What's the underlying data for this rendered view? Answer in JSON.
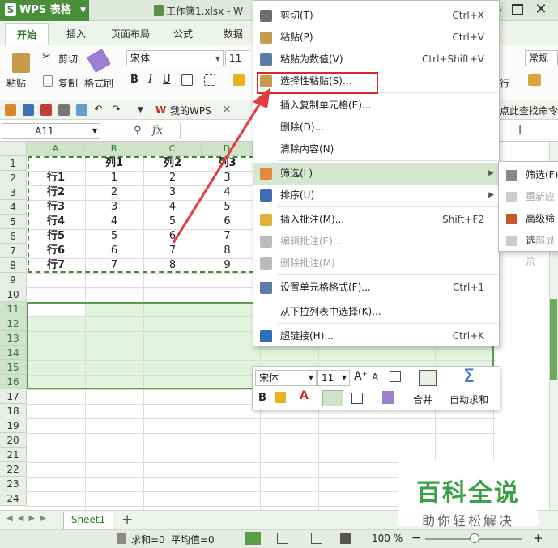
{
  "app": {
    "logo": "WPS 表格",
    "doc_title": "工作簿1.xlsx - W"
  },
  "ribbon_tabs": [
    "开始",
    "插入",
    "页面布局",
    "公式",
    "数据"
  ],
  "ribbon": {
    "cut": "剪切",
    "paste": "粘贴",
    "copy": "复制",
    "format_painter": "格式刷",
    "font_name": "宋体",
    "font_size": "11",
    "bold": "B",
    "italic": "I",
    "underline": "U",
    "regular": "常规",
    "row_col": "行"
  },
  "qat": {
    "my_wps": "我的WPS",
    "find_cmd": "点此查找命令"
  },
  "formula_bar": {
    "name_box": "A11",
    "fx": "fx"
  },
  "grid": {
    "columns": [
      "A",
      "B",
      "C",
      "D"
    ],
    "rows": [
      "1",
      "2",
      "3",
      "4",
      "5",
      "6",
      "7",
      "8",
      "9",
      "10",
      "11",
      "12",
      "13",
      "14",
      "15",
      "16",
      "17",
      "18",
      "19",
      "20",
      "21",
      "22",
      "23",
      "24"
    ],
    "header_row": [
      "",
      "列1",
      "列2",
      "列3"
    ],
    "data": [
      [
        "行1",
        "1",
        "2",
        "3"
      ],
      [
        "行2",
        "2",
        "3",
        "4"
      ],
      [
        "行3",
        "3",
        "4",
        "5"
      ],
      [
        "行4",
        "4",
        "5",
        "6"
      ],
      [
        "行5",
        "5",
        "6",
        "7"
      ],
      [
        "行6",
        "6",
        "7",
        "8"
      ],
      [
        "行7",
        "7",
        "8",
        "9"
      ]
    ]
  },
  "context_menu": [
    {
      "label": "剪切(T)",
      "shortcut": "Ctrl+X"
    },
    {
      "label": "粘贴(P)",
      "shortcut": "Ctrl+V"
    },
    {
      "label": "粘贴为数值(V)",
      "shortcut": "Ctrl+Shift+V"
    },
    {
      "label": "选择性粘贴(S)...",
      "shortcut": ""
    },
    {
      "label": "插入复制单元格(E)...",
      "shortcut": ""
    },
    {
      "label": "删除(D)...",
      "shortcut": ""
    },
    {
      "label": "清除内容(N)",
      "shortcut": ""
    },
    {
      "label": "筛选(L)",
      "shortcut": ""
    },
    {
      "label": "排序(U)",
      "shortcut": ""
    },
    {
      "label": "插入批注(M)...",
      "shortcut": "Shift+F2"
    },
    {
      "label": "编辑批注(E)...",
      "shortcut": ""
    },
    {
      "label": "删除批注(M)",
      "shortcut": ""
    },
    {
      "label": "设置单元格格式(F)...",
      "shortcut": "Ctrl+1"
    },
    {
      "label": "从下拉列表中选择(K)...",
      "shortcut": ""
    },
    {
      "label": "超链接(H)...",
      "shortcut": "Ctrl+K"
    }
  ],
  "submenu": [
    "筛选(F)",
    "重新应用",
    "高级筛选",
    "全部显示"
  ],
  "mini_toolbar": {
    "font_name": "宋体",
    "font_size": "11",
    "merge": "合并",
    "autosum": "自动求和",
    "bold": "B"
  },
  "sheet_tab": "Sheet1",
  "status": {
    "sum": "求和=0",
    "avg": "平均值=0",
    "zoom": "100 %"
  },
  "watermark": {
    "main": "百科全说",
    "sub": "助你轻松解决"
  },
  "colors": {
    "accent": "#4a8e3b",
    "selection_fill": "#e2f5dc",
    "highlight_box": "#d9292b",
    "arrow": "#e03c3c"
  }
}
